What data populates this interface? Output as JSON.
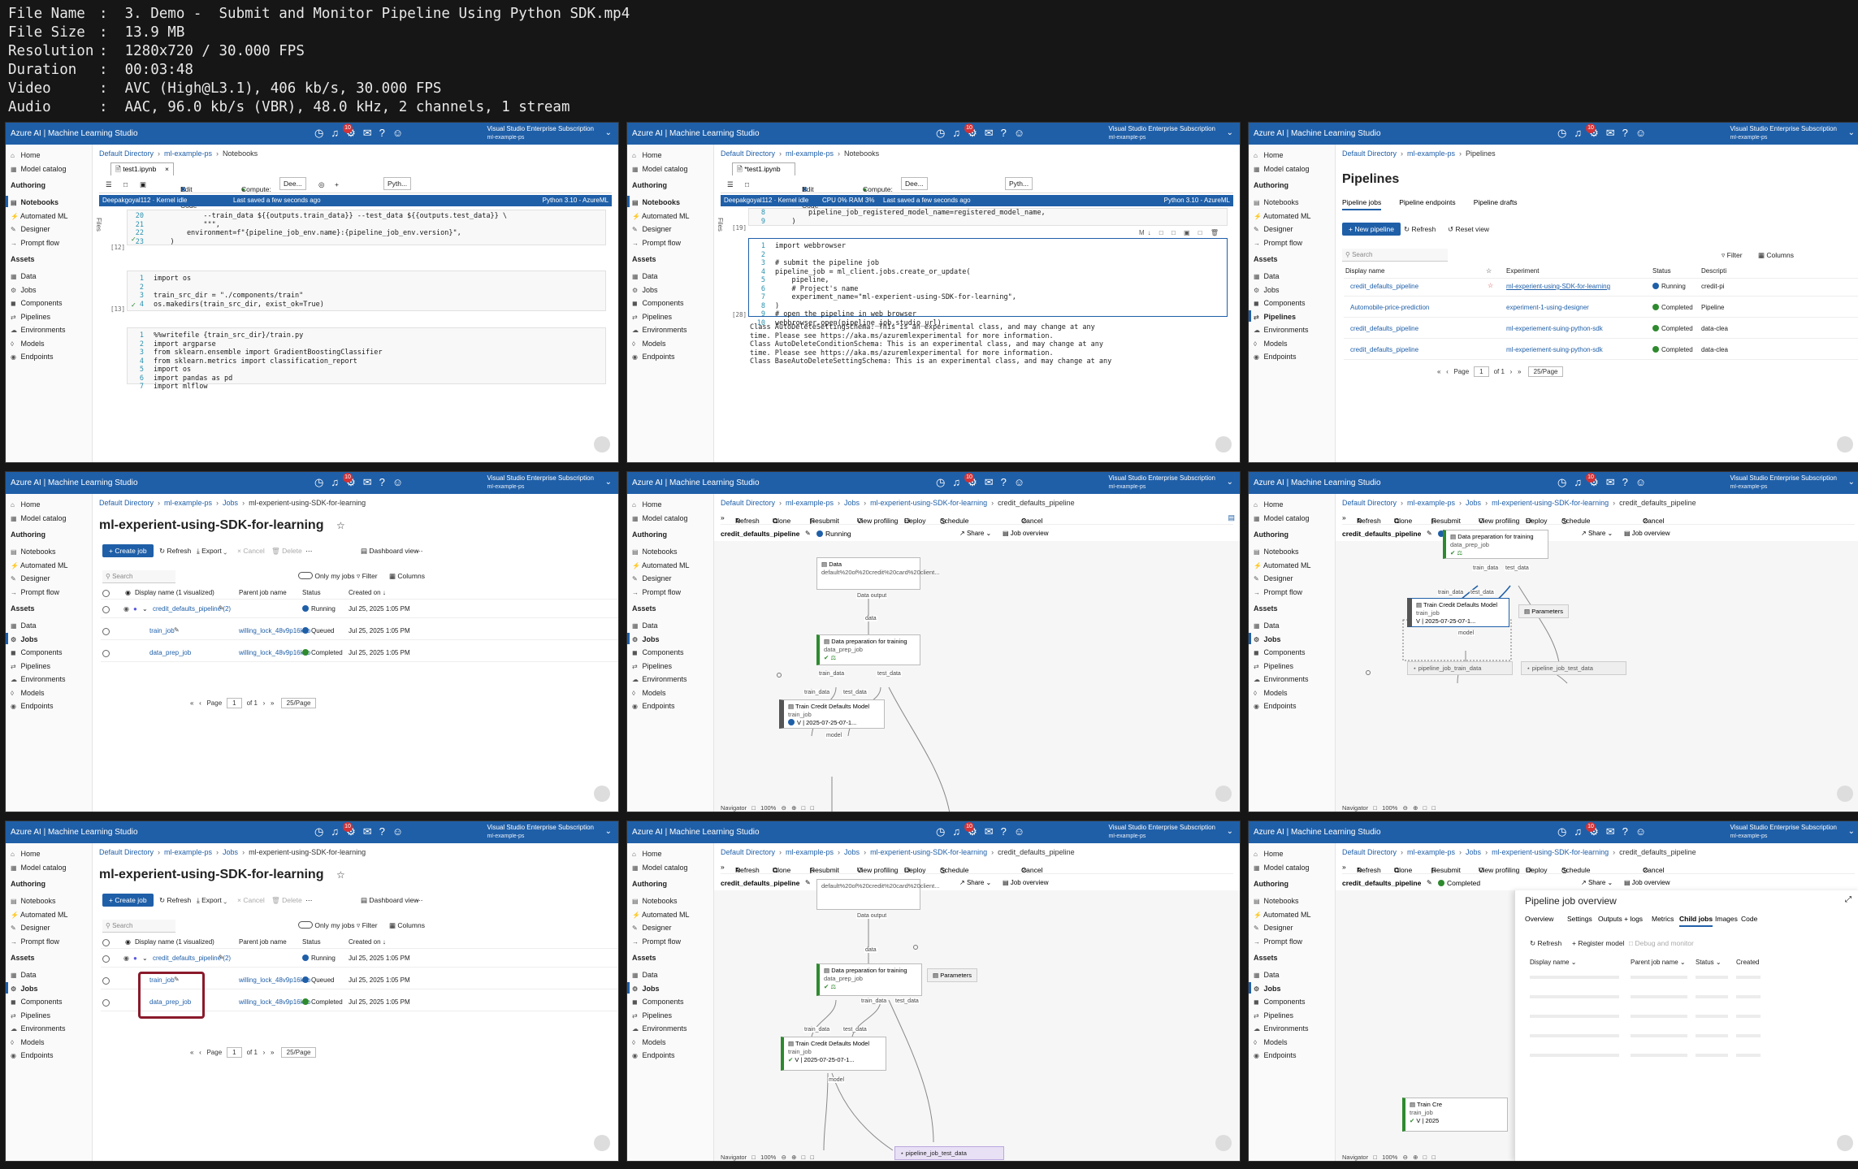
{
  "file_info": [
    {
      "key": "File Name",
      "value": "3. Demo -  Submit and Monitor Pipeline Using Python SDK.mp4"
    },
    {
      "key": "File Size",
      "value": "13.9 MB"
    },
    {
      "key": "Resolution",
      "value": "1280x720 / 30.000 FPS"
    },
    {
      "key": "Duration",
      "value": "00:03:48"
    },
    {
      "key": "Video",
      "value": "AVC (High@L3.1), 406 kb/s, 30.000 FPS"
    },
    {
      "key": "Audio",
      "value": "AAC, 96.0 kb/s (VBR), 48.0 kHz, 2 channels, 1 stream"
    }
  ],
  "app": {
    "brand": "Azure AI | Machine Learning Studio",
    "subscription": "Visual Studio Enterprise Subscription",
    "workspace": "ml-example-ps",
    "notif_count": "10",
    "colors": {
      "header": "#1f5fa8",
      "accent": "#1f5fa8",
      "success": "#2e8a2e",
      "highlight": "#8b1a2b"
    }
  },
  "sidebar": {
    "items": [
      "Home",
      "Model catalog"
    ],
    "authoring_heading": "Authoring",
    "authoring": [
      "Notebooks",
      "Automated ML",
      "Designer",
      "Prompt flow"
    ],
    "assets_heading": "Assets",
    "assets": [
      "Data",
      "Jobs",
      "Components",
      "Pipelines",
      "Environments",
      "Models",
      "Endpoints"
    ]
  },
  "crumbs": {
    "dir": "Default Directory",
    "ws": "ml-example-ps",
    "notebooks": "Notebooks",
    "pipelines": "Pipelines",
    "jobs": "Jobs",
    "experiment": "ml-experient-using-SDK-for-learning",
    "pipeline": "credit_defaults_pipeline"
  },
  "notebook": {
    "tab": "test1.ipynb",
    "tab_dirty": "*test1.ipynb",
    "edit_vscode": "Edit in VS Code",
    "compute_label": "Compute:",
    "compute_value": "Dee...",
    "kernel_value": "Pyth...",
    "status1": "Deepakgoyal112 · Kernel idle",
    "status1_saved": "Last saved a few seconds ago",
    "status1_py": "Python 3.10 - AzureML",
    "status2_cpu": "CPU  0%   RAM  3%",
    "files_label": "Files",
    "exec12": "[12]",
    "exec13": "[13]",
    "exec19": "[19]",
    "exec28": "[28]",
    "code_a": [
      "            --train_data ${{outputs.train_data}} --test_data ${{outputs.test_data}} \\",
      "            \"\"\",",
      "        environment=f\"{pipeline_job_env.name}:{pipeline_job_env.version}\",",
      "    )"
    ],
    "code_a_ln": [
      "20",
      "21",
      "22",
      "23"
    ],
    "code_b": [
      "import os",
      "",
      "train_src_dir = \"./components/train\"",
      "os.makedirs(train_src_dir, exist_ok=True)"
    ],
    "code_c": [
      "%%writefile {train_src_dir}/train.py",
      "import argparse",
      "from sklearn.ensemble import GradientBoostingClassifier",
      "from sklearn.metrics import classification_report",
      "import os",
      "import pandas as pd",
      "import mlflow"
    ],
    "code_d_top": [
      "        pipeline_job_registered_model_name=registered_model_name,",
      "    )"
    ],
    "code_d_top_ln": [
      "8",
      "9"
    ],
    "code_e": [
      "import webbrowser",
      "",
      "# submit the pipeline job",
      "pipeline_job = ml_client.jobs.create_or_update(",
      "    pipeline,",
      "    # Project's name",
      "    experiment_name=\"ml-experient-using-SDK-for-learning\",",
      ")",
      "# open the pipeline in web browser",
      "webbrowser.open(pipeline_job.studio_url)"
    ],
    "output": [
      "Class AutoDeleteSettingSchema: This is an experimental class, and may change at any",
      "time. Please see https://aka.ms/azuremlexperimental for more information.",
      "Class AutoDeleteConditionSchema: This is an experimental class, and may change at any",
      "time. Please see https://aka.ms/azuremlexperimental for more information.",
      "Class BaseAutoDeleteSettingSchema: This is an experimental class, and may change at any"
    ]
  },
  "pipelines_page": {
    "title": "Pipelines",
    "tabs": [
      "Pipeline jobs",
      "Pipeline endpoints",
      "Pipeline drafts"
    ],
    "new_btn": "+ New pipeline",
    "refresh": "Refresh",
    "reset": "Reset view",
    "search": "Search",
    "filter": "Filter",
    "columns": "Columns",
    "headers": [
      "Display name",
      "Experiment",
      "Status",
      "Descripti"
    ],
    "rows": [
      {
        "name": "credit_defaults_pipeline",
        "exp": "ml-experient-using-SDK-for-learning",
        "status": "Running",
        "desc": "credit-pi"
      },
      {
        "name": "Automobile-price-prediction",
        "exp": "experiment-1-using-designer",
        "status": "Completed",
        "desc": "Pipeline"
      },
      {
        "name": "credit_defaults_pipeline",
        "exp": "ml-experiement-suing-python-sdk",
        "status": "Completed",
        "desc": "data-clea"
      },
      {
        "name": "credit_defaults_pipeline",
        "exp": "ml-experiement-suing-python-sdk",
        "status": "Completed",
        "desc": "data-clea"
      }
    ],
    "page_label": "Page",
    "page": "1",
    "of": "of 1",
    "per_page": "25/Page"
  },
  "experiment_page": {
    "title": "ml-experient-using-SDK-for-learning",
    "create_job": "+ Create job",
    "refresh": "Refresh",
    "export": "Export",
    "cancel": "Cancel",
    "delete": "Delete",
    "dashboard": "Dashboard view",
    "search": "Search",
    "only_mine": "Only my jobs",
    "filter": "Filter",
    "columns": "Columns",
    "headers": [
      "Display name (1 visualized)",
      "Parent job name",
      "Status",
      "Created on"
    ],
    "rows": [
      {
        "name": "credit_defaults_pipeline (2)",
        "parent": "",
        "status": "Running",
        "created": "Jul 25, 2025 1:05 PM"
      },
      {
        "name": "train_job",
        "parent": "willing_lock_48v9p16kxb",
        "status": "Queued",
        "created": "Jul 25, 2025 1:05 PM"
      },
      {
        "name": "data_prep_job",
        "parent": "willing_lock_48v9p16kxb",
        "status": "Completed",
        "created": "Jul 25, 2025 1:05 PM"
      }
    ],
    "page_label": "Page",
    "page": "1",
    "of": "of 1",
    "per_page": "25/Page"
  },
  "graph": {
    "toolbar": [
      "Refresh",
      "Clone",
      "Resubmit",
      "View profiling",
      "Deploy",
      "Schedule",
      "Cancel"
    ],
    "name": "credit_defaults_pipeline",
    "running": "Running",
    "completed": "Completed",
    "share": "Share",
    "job_overview": "Job overview",
    "data_node_title": "Data",
    "data_node_sub": "default%20of%20credit%20card%20client...",
    "data_output": "Data output",
    "data_port": "data",
    "prep_title": "Data preparation for training",
    "prep_sub": "data_prep_job",
    "train_title": "Train Credit Defaults Model",
    "train_sub": "train_job",
    "train_ver": "V | 2025-07-25-07-1...",
    "train_data": "train_data",
    "test_data": "test_data",
    "model": "model",
    "parameters": "Parameters",
    "out_train": "pipeline_job_train_data",
    "out_test": "pipeline_job_test_data",
    "navigator": "Navigator",
    "zoom": "100%"
  },
  "overview_panel": {
    "title": "Pipeline job overview",
    "tabs": [
      "Overview",
      "Settings",
      "Outputs + logs",
      "Metrics",
      "Child jobs",
      "Images",
      "Code"
    ],
    "refresh": "Refresh",
    "register": "Register model",
    "debug": "Debug and monitor",
    "headers": [
      "Display name",
      "Parent job name",
      "Status",
      "Created"
    ],
    "mini_title": "Train Cre",
    "mini_sub": "train_job",
    "mini_ver": "V | 2025"
  }
}
